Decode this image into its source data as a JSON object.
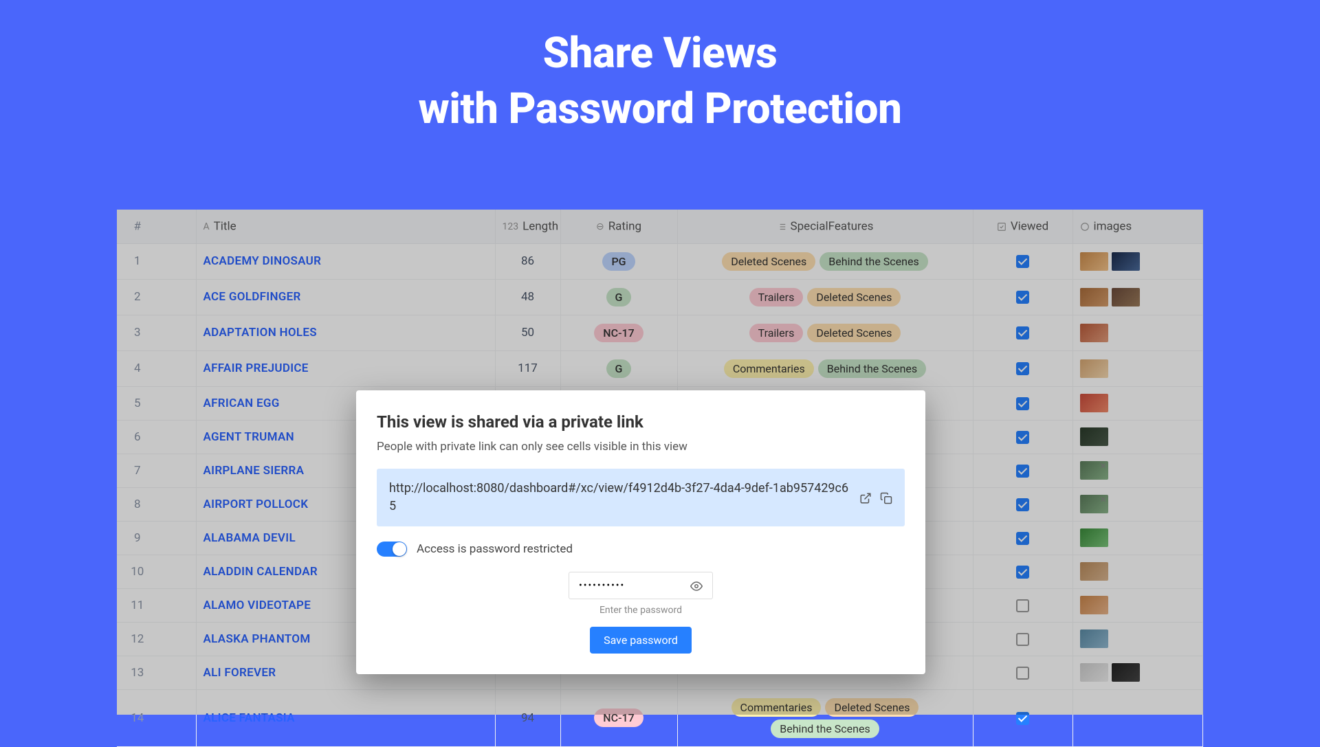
{
  "hero": {
    "line1": "Share Views",
    "line2": "with Password Protection"
  },
  "columns": {
    "num": "#",
    "title": "Title",
    "length": "Length",
    "rating": "Rating",
    "sf": "SpecialFeatures",
    "viewed": "Viewed",
    "images": "images"
  },
  "hicons": {
    "title": "A",
    "length": "123",
    "rating": "⊖",
    "sf": "list",
    "viewed": "check",
    "images": "attach"
  },
  "rows": [
    {
      "n": "1",
      "title": "ACADEMY DINOSAUR",
      "length": "86",
      "rating": "PG",
      "ratingCls": "pg",
      "sf": [
        {
          "t": "Deleted Scenes",
          "c": "ds"
        },
        {
          "t": "Behind the Scenes",
          "c": "bs"
        }
      ],
      "viewed": true,
      "imgs": [
        "t1",
        "t2"
      ]
    },
    {
      "n": "2",
      "title": "ACE GOLDFINGER",
      "length": "48",
      "rating": "G",
      "ratingCls": "g",
      "sf": [
        {
          "t": "Trailers",
          "c": "tr"
        },
        {
          "t": "Deleted Scenes",
          "c": "ds"
        }
      ],
      "viewed": true,
      "imgs": [
        "t3",
        "t4"
      ]
    },
    {
      "n": "3",
      "title": "ADAPTATION HOLES",
      "length": "50",
      "rating": "NC-17",
      "ratingCls": "nc",
      "sf": [
        {
          "t": "Trailers",
          "c": "tr"
        },
        {
          "t": "Deleted Scenes",
          "c": "ds"
        }
      ],
      "viewed": true,
      "imgs": [
        "t5"
      ]
    },
    {
      "n": "4",
      "title": "AFFAIR PREJUDICE",
      "length": "117",
      "rating": "G",
      "ratingCls": "g",
      "sf": [
        {
          "t": "Commentaries",
          "c": "cm"
        },
        {
          "t": "Behind the Scenes",
          "c": "bs"
        }
      ],
      "viewed": true,
      "imgs": [
        "t6"
      ]
    },
    {
      "n": "5",
      "title": "AFRICAN EGG",
      "length": "",
      "rating": "",
      "ratingCls": "",
      "sf": [],
      "viewed": true,
      "imgs": [
        "t7"
      ]
    },
    {
      "n": "6",
      "title": "AGENT TRUMAN",
      "length": "",
      "rating": "",
      "ratingCls": "",
      "sf": [],
      "viewed": true,
      "imgs": [
        "t8"
      ]
    },
    {
      "n": "7",
      "title": "AIRPLANE SIERRA",
      "length": "",
      "rating": "",
      "ratingCls": "",
      "sf": [],
      "viewed": true,
      "imgs": [
        "t9 tx"
      ]
    },
    {
      "n": "8",
      "title": "AIRPORT POLLOCK",
      "length": "",
      "rating": "",
      "ratingCls": "",
      "sf": [],
      "viewed": true,
      "imgs": [
        "t9 tx"
      ]
    },
    {
      "n": "9",
      "title": "ALABAMA DEVIL",
      "length": "",
      "rating": "",
      "ratingCls": "",
      "sf": [],
      "viewed": true,
      "imgs": [
        "t10"
      ]
    },
    {
      "n": "10",
      "title": "ALADDIN CALENDAR",
      "length": "",
      "rating": "",
      "ratingCls": "",
      "sf": [],
      "viewed": true,
      "imgs": [
        "t11"
      ]
    },
    {
      "n": "11",
      "title": "ALAMO VIDEOTAPE",
      "length": "",
      "rating": "",
      "ratingCls": "",
      "sf": [],
      "viewed": false,
      "imgs": [
        "t12"
      ]
    },
    {
      "n": "12",
      "title": "ALASKA PHANTOM",
      "length": "",
      "rating": "",
      "ratingCls": "",
      "sf": [],
      "viewed": false,
      "imgs": [
        "t13"
      ]
    },
    {
      "n": "13",
      "title": "ALI FOREVER",
      "length": "",
      "rating": "",
      "ratingCls": "",
      "sf": [],
      "viewed": false,
      "imgs": [
        "t14",
        "t15"
      ]
    },
    {
      "n": "14",
      "title": "ALICE FANTASIA",
      "length": "94",
      "rating": "NC-17",
      "ratingCls": "nc",
      "sf": [
        {
          "t": "Commentaries",
          "c": "cm"
        },
        {
          "t": "Deleted Scenes",
          "c": "ds"
        },
        {
          "t": "Behind the Scenes",
          "c": "bs"
        }
      ],
      "viewed": true,
      "imgs": []
    }
  ],
  "modal": {
    "title": "This view is shared via a private link",
    "subtitle": "People with private link can only see cells visible in this view",
    "url": "http://localhost:8080/dashboard#/xc/view/f4912d4b-3f27-4da4-9def-1ab957429c65",
    "toggle_label": "Access is password restricted",
    "password_value": "••••••••••",
    "password_hint": "Enter the password",
    "save_label": "Save password"
  }
}
